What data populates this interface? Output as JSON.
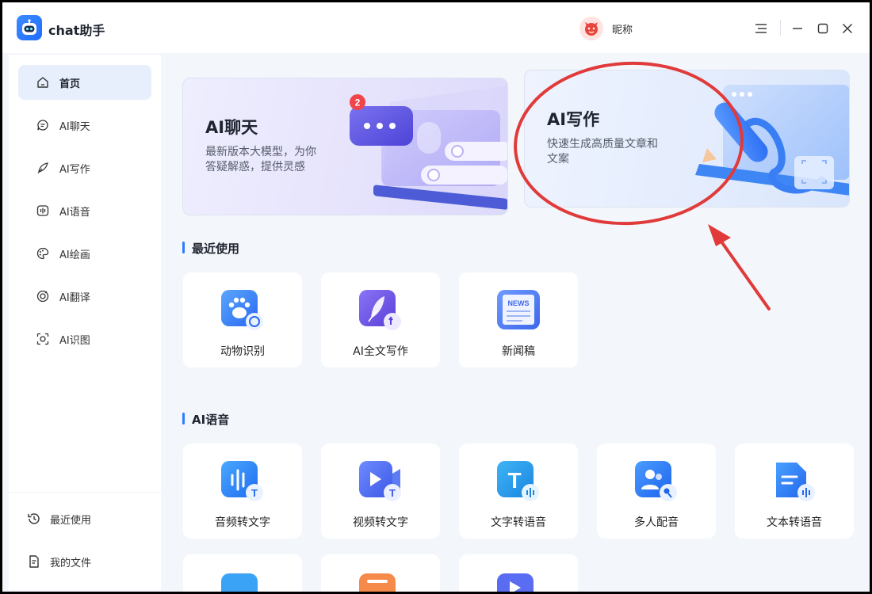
{
  "app": {
    "title": "chat助手",
    "nickname": "昵称"
  },
  "sidebar": {
    "items": [
      {
        "label": "首页",
        "icon": "home-icon",
        "active": true
      },
      {
        "label": "AI聊天",
        "icon": "chat-bubble-icon"
      },
      {
        "label": "AI写作",
        "icon": "quill-icon"
      },
      {
        "label": "AI语音",
        "icon": "audio-wave-icon"
      },
      {
        "label": "AI绘画",
        "icon": "palette-icon"
      },
      {
        "label": "AI翻译",
        "icon": "translate-icon"
      },
      {
        "label": "AI识图",
        "icon": "scan-icon"
      }
    ],
    "bottom": [
      {
        "label": "最近使用",
        "icon": "history-icon"
      },
      {
        "label": "我的文件",
        "icon": "file-icon"
      }
    ]
  },
  "banners": {
    "chat": {
      "title": "AI聊天",
      "desc_line1": "最新版本大模型，为你",
      "desc_line2": "答疑解惑，提供灵感",
      "badge": "2"
    },
    "write": {
      "title": "AI写作",
      "desc_line1": "快速生成高质量文章和",
      "desc_line2": "文案"
    }
  },
  "sections": {
    "recent": {
      "title": "最近使用",
      "cards": [
        {
          "label": "动物识别",
          "icon": "paw-scan-icon"
        },
        {
          "label": "AI全文写作",
          "icon": "feather-write-icon"
        },
        {
          "label": "新闻稿",
          "icon": "news-icon",
          "icon_text": "NEWS"
        }
      ]
    },
    "voice": {
      "title": "AI语音",
      "cards": [
        {
          "label": "音频转文字",
          "icon": "audio-to-text-icon",
          "icon_text": "T"
        },
        {
          "label": "视频转文字",
          "icon": "video-to-text-icon",
          "icon_text": "T"
        },
        {
          "label": "文字转语音",
          "icon": "text-to-speech-icon",
          "icon_text": "T"
        },
        {
          "label": "多人配音",
          "icon": "multi-voice-icon"
        },
        {
          "label": "文本转语音",
          "icon": "document-to-speech-icon"
        }
      ]
    }
  },
  "colors": {
    "accent": "#2f7bff",
    "annotation": "#e03a3a"
  }
}
